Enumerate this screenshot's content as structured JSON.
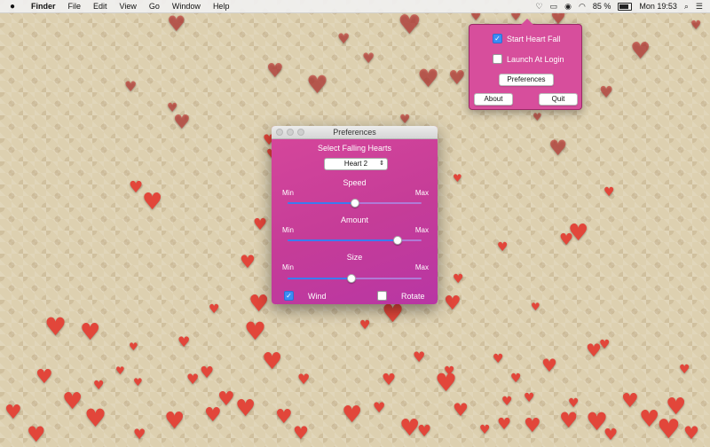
{
  "menubar": {
    "apple_icon": "apple-icon",
    "app": "Finder",
    "items": [
      "File",
      "Edit",
      "View",
      "Go",
      "Window",
      "Help"
    ],
    "status": {
      "heart_icon": "heart-outline-icon",
      "battery_percent": "85 %",
      "time": "Mon 19:53"
    }
  },
  "popover": {
    "start_heart_fall": {
      "label": "Start Heart Fall",
      "checked": true
    },
    "launch_at_login": {
      "label": "Launch At Login",
      "checked": false
    },
    "preferences_button": "Preferences",
    "about_button": "About",
    "quit_button": "Quit"
  },
  "preferences": {
    "title": "Preferences",
    "select_label": "Select Falling Hearts",
    "selected_heart": "Heart 2",
    "speed": {
      "label": "Speed",
      "min": "Min",
      "max": "Max",
      "value": 0.5
    },
    "amount": {
      "label": "Amount",
      "min": "Min",
      "max": "Max",
      "value": 0.82
    },
    "size": {
      "label": "Size",
      "min": "Min",
      "max": "Max",
      "value": 0.48
    },
    "wind": {
      "label": "Wind",
      "checked": true
    },
    "rotate": {
      "label": "Rotate",
      "checked": false
    }
  },
  "colors": {
    "heart": "#e2463a",
    "panel_pink": "#d74e9c",
    "accent_blue": "#3b8cf5"
  }
}
